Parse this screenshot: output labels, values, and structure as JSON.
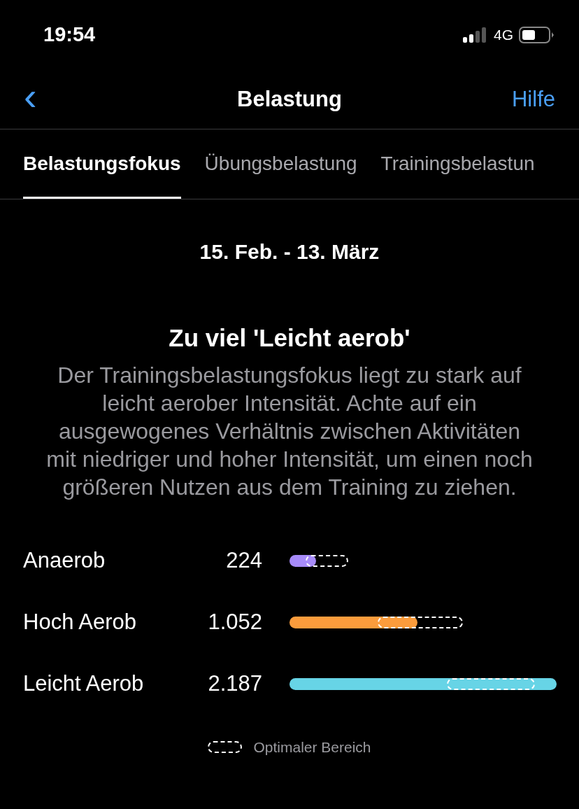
{
  "status_bar": {
    "time": "19:54",
    "network": "4G"
  },
  "nav": {
    "back": "‹",
    "title": "Belastung",
    "help": "Hilfe"
  },
  "tabs": [
    {
      "label": "Belastungsfokus",
      "selected": true
    },
    {
      "label": "Übungsbelastung",
      "selected": false
    },
    {
      "label": "Trainingsbelastun",
      "selected": false
    }
  ],
  "date_range": "15. Feb. - 13. März",
  "heading": "Zu viel 'Leicht aerob'",
  "description": "Der Trainingsbelastungsfokus liegt zu stark auf leicht aerober Intensität. Achte auf ein ausgewogenes Verhältnis zwischen Aktivitäten mit niedriger und hoher Intensität, um einen noch größeren Nutzen aus dem Training zu ziehen.",
  "loads": [
    {
      "name": "Anaerob",
      "value": "224",
      "color": "#a78bfa"
    },
    {
      "name": "Hoch Aerob",
      "value": "1.052",
      "color": "#fb9c3c"
    },
    {
      "name": "Leicht Aerob",
      "value": "2.187",
      "color": "#67d4e6"
    }
  ],
  "legend": "Optimaler Bereich"
}
